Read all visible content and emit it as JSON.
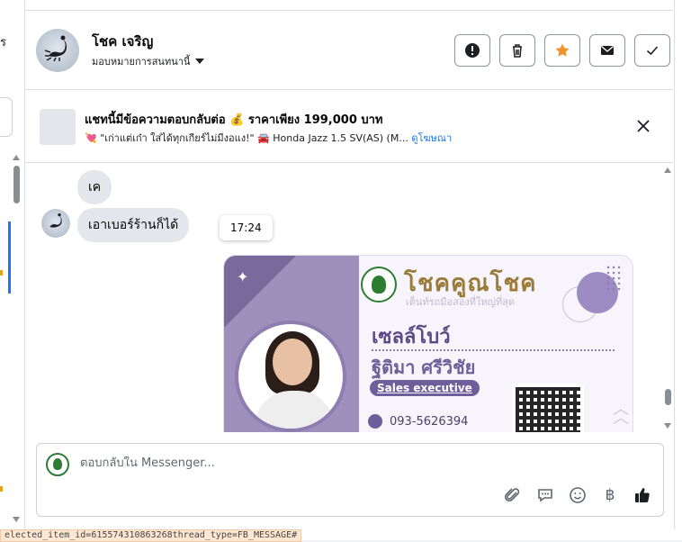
{
  "header": {
    "contact_name": "โชค เจริญ",
    "assign_label": "มอบหมายการสนทนานี้",
    "actions": [
      {
        "name": "report-button",
        "icon": "exclamation-icon"
      },
      {
        "name": "delete-button",
        "icon": "trash-icon"
      },
      {
        "name": "star-button",
        "icon": "star-icon",
        "color": "#f0932b"
      },
      {
        "name": "mail-button",
        "icon": "envelope-icon"
      },
      {
        "name": "done-button",
        "icon": "checkmark-icon"
      }
    ]
  },
  "ad_banner": {
    "title": "แชทนี้มีข้อความตอบกลับต่อ 💰 ราคาเพียง 199,000 บาท",
    "subtitle": "💘 \"เก่าแต่เก๋า ใส่ได้ทุกเกียร์ไม่มีงอแง!\" 🚘 Honda Jazz 1.5 SV(AS) (M...",
    "link_label": "ดูโฆษณา"
  },
  "messages": [
    {
      "text": "เค"
    },
    {
      "text": "เอาเบอร์ร้านก็ได้"
    }
  ],
  "tooltip_time": "17:24",
  "business_card": {
    "brand": "โชคคูณโชค",
    "tagline": "เต็นท์รถมือสองที่ใหญ่ที่สุด",
    "nickname": "เซลล์โบว์",
    "full_name": "ฐิติมา ศรีวิชัย",
    "role": "Sales executive",
    "phone": "093-5626394"
  },
  "composer": {
    "placeholder": "ตอบกลับใน Messenger...",
    "tools": [
      "paperclip-icon",
      "speech-bubble-icon",
      "smiley-icon",
      "baht-icon",
      "thumbs-up-icon"
    ],
    "baht_glyph": "฿"
  },
  "left_panel": {
    "fragment": "ร"
  },
  "status_bar": "elected_item_id=615574310863268thread_type=FB_MESSAGE#",
  "colors": {
    "accent": "#1877f2",
    "star": "#f0932b",
    "bubble": "#e4e6eb"
  }
}
